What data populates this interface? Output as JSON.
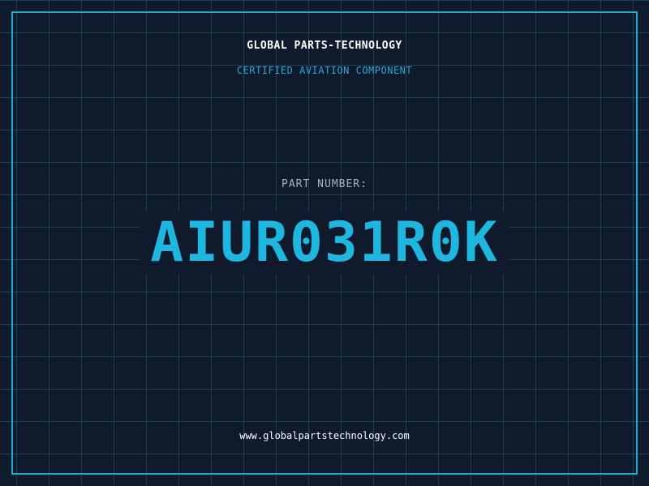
{
  "brand": {
    "title": "GLOBAL PARTS-TECHNOLOGY",
    "subtitle": "CERTIFIED AVIATION COMPONENT"
  },
  "part": {
    "label": "PART NUMBER:",
    "number": "AIUR031R0K"
  },
  "footer": {
    "website": "www.globalpartstechnology.com"
  },
  "colors": {
    "background": "#0f1a2d",
    "grid": "#1d4257",
    "border": "#1fa9cf",
    "accent": "#1fb6e0",
    "subtitle": "#2aa7d4",
    "label": "#a9b3c0",
    "text": "#ffffff"
  }
}
